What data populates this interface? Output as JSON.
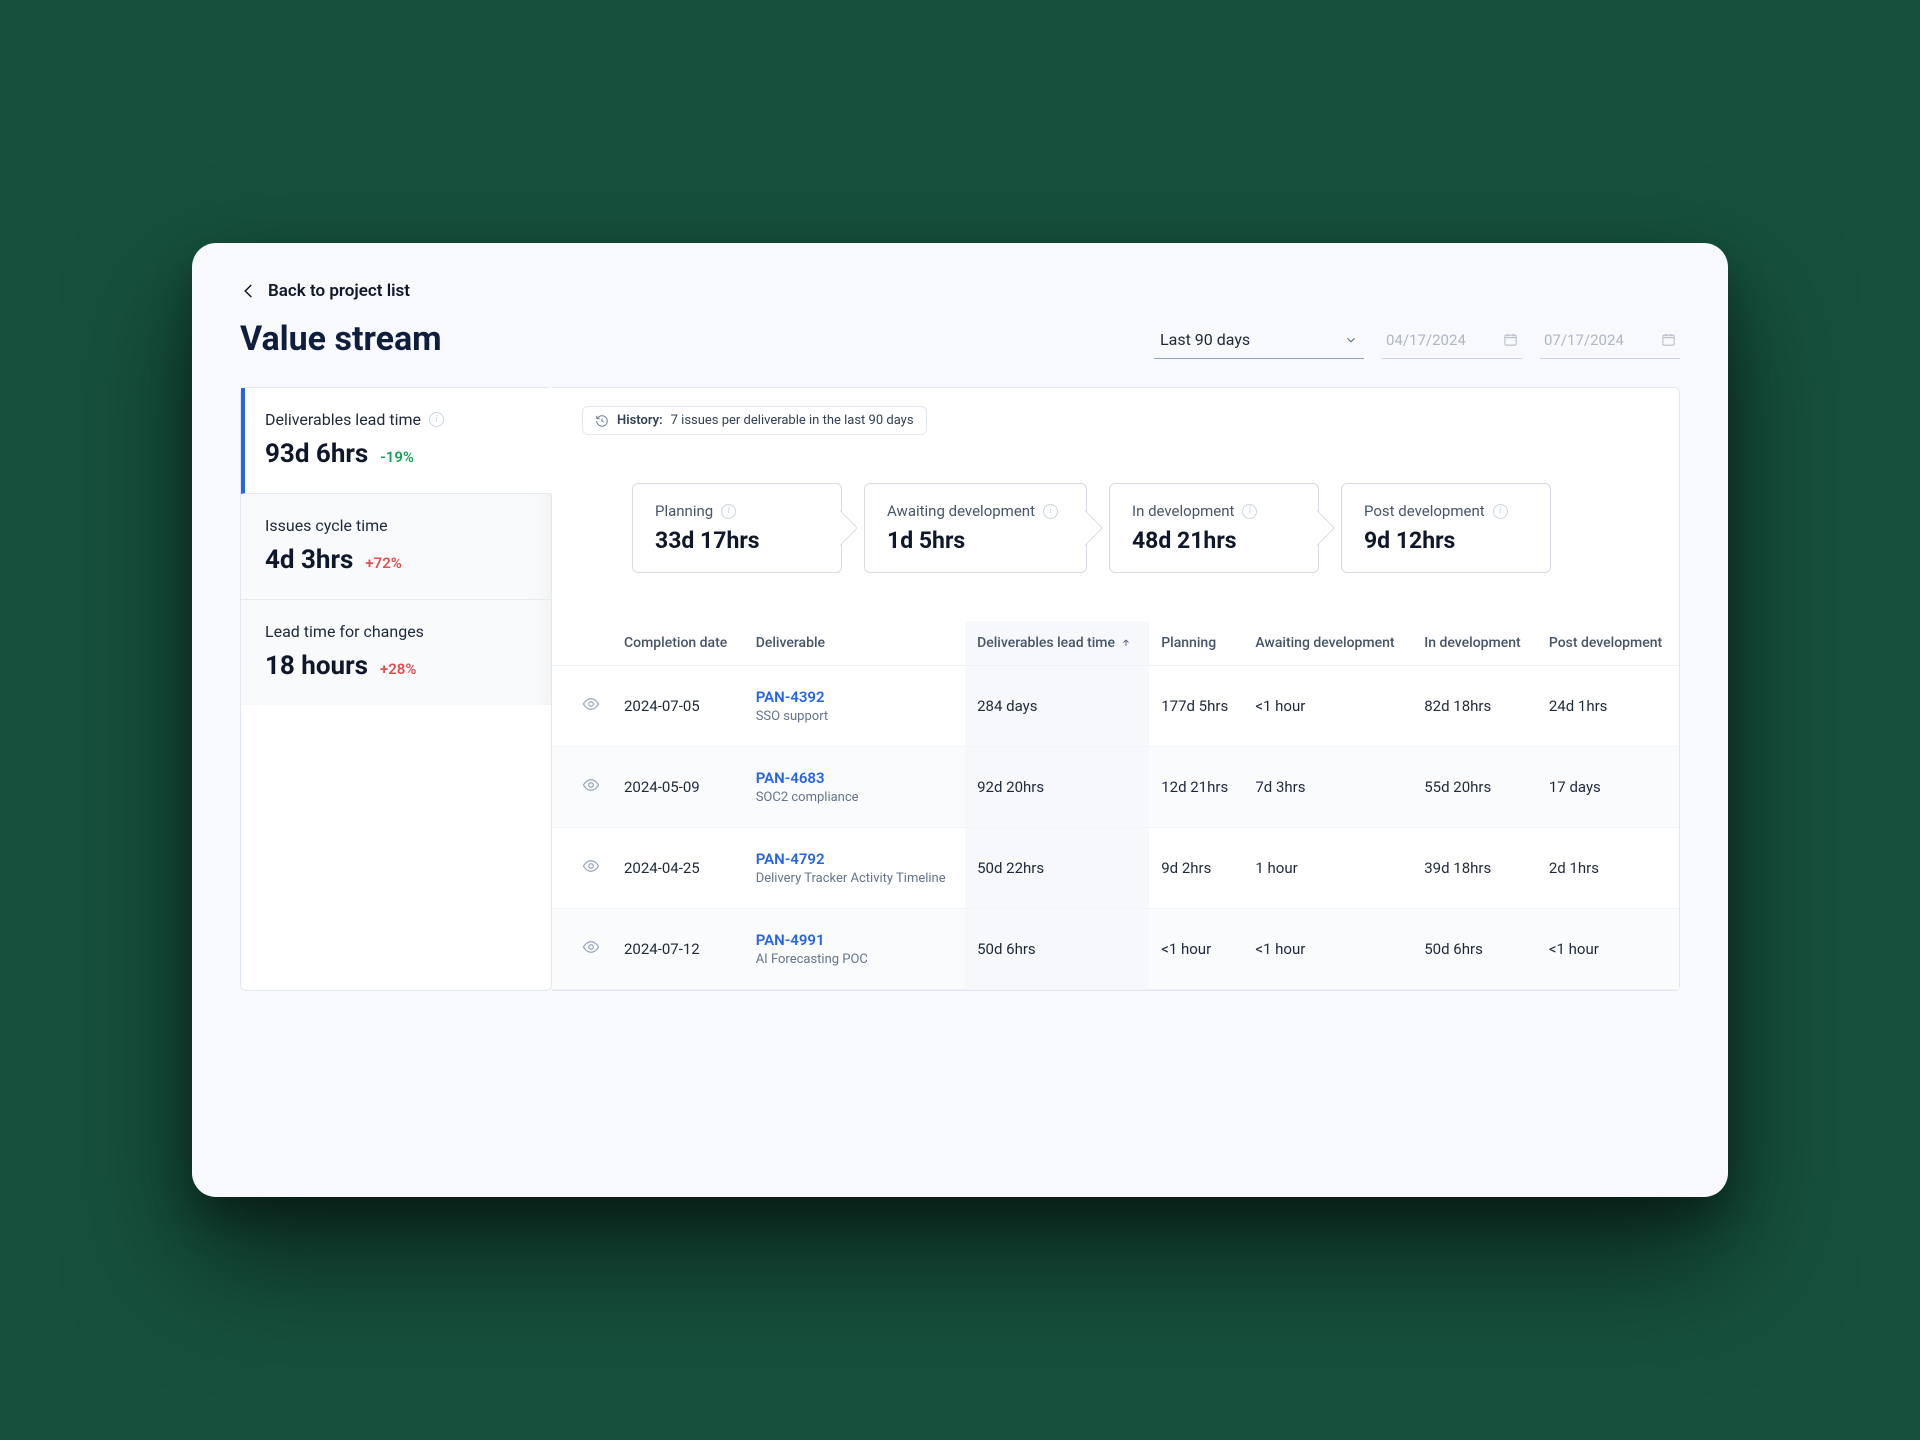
{
  "back_label": "Back to project list",
  "page_title": "Value stream",
  "range_select": {
    "value": "Last 90 days"
  },
  "date_from": "04/17/2024",
  "date_to": "07/17/2024",
  "metrics": [
    {
      "label": "Deliverables lead time",
      "value": "93d 6hrs",
      "delta": "-19%",
      "delta_dir": "neg"
    },
    {
      "label": "Issues cycle time",
      "value": "4d 3hrs",
      "delta": "+72%",
      "delta_dir": "pos"
    },
    {
      "label": "Lead time for changes",
      "value": "18 hours",
      "delta": "+28%",
      "delta_dir": "pos"
    }
  ],
  "history_label": "History:",
  "history_text": "7 issues per deliverable in the last 90 days",
  "stages": [
    {
      "label": "Planning",
      "value": "33d 17hrs"
    },
    {
      "label": "Awaiting development",
      "value": "1d 5hrs"
    },
    {
      "label": "In development",
      "value": "48d 21hrs"
    },
    {
      "label": "Post development",
      "value": "9d 12hrs"
    }
  ],
  "columns": {
    "completion": "Completion date",
    "deliverable": "Deliverable",
    "leadtime": "Deliverables lead time",
    "planning": "Planning",
    "awaiting": "Awaiting development",
    "indev": "In development",
    "post": "Post development"
  },
  "rows": [
    {
      "date": "2024-07-05",
      "id": "PAN-4392",
      "name": "SSO support",
      "leadtime": "284 days",
      "planning": "177d 5hrs",
      "awaiting": "<1 hour",
      "indev": "82d 18hrs",
      "post": "24d 1hrs"
    },
    {
      "date": "2024-05-09",
      "id": "PAN-4683",
      "name": "SOC2 compliance",
      "leadtime": "92d 20hrs",
      "planning": "12d 21hrs",
      "awaiting": "7d 3hrs",
      "indev": "55d 20hrs",
      "post": "17 days"
    },
    {
      "date": "2024-04-25",
      "id": "PAN-4792",
      "name": "Delivery Tracker Activity Timeline",
      "leadtime": "50d 22hrs",
      "planning": "9d 2hrs",
      "awaiting": "1 hour",
      "indev": "39d 18hrs",
      "post": "2d 1hrs"
    },
    {
      "date": "2024-07-12",
      "id": "PAN-4991",
      "name": "AI Forecasting POC",
      "leadtime": "50d 6hrs",
      "planning": "<1 hour",
      "awaiting": "<1 hour",
      "indev": "50d 6hrs",
      "post": "<1 hour"
    }
  ]
}
